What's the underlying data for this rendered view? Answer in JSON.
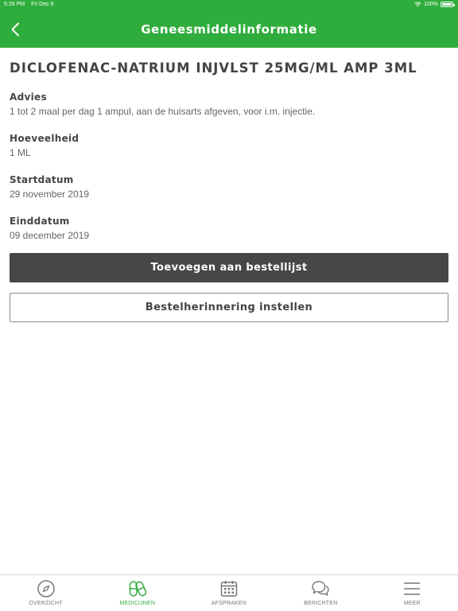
{
  "status_bar": {
    "time": "5:26 PM",
    "date": "Fri Dec 6",
    "battery": "100%"
  },
  "header": {
    "title": "Geneesmiddelinformatie"
  },
  "medication": {
    "name": "DICLOFENAC-NATRIUM INJVLST 25MG/ML AMP 3ML",
    "fields": [
      {
        "label": "Advies",
        "value": "1 tot 2 maal per dag 1 ampul, aan de huisarts afgeven, voor i.m. injectie."
      },
      {
        "label": "Hoeveelheid",
        "value": "1 ML"
      },
      {
        "label": "Startdatum",
        "value": "29 november 2019"
      },
      {
        "label": "Einddatum",
        "value": "09 december 2019"
      }
    ]
  },
  "actions": {
    "add_to_list": "Toevoegen aan bestellijst",
    "set_reminder": "Bestelherinnering instellen"
  },
  "tabs": [
    {
      "label": "OVERZICHT",
      "icon": "compass-icon",
      "active": false
    },
    {
      "label": "MEDICIJNEN",
      "icon": "pills-icon",
      "active": true
    },
    {
      "label": "AFSPRAKEN",
      "icon": "calendar-icon",
      "active": false
    },
    {
      "label": "BERICHTEN",
      "icon": "chat-bubbles-icon",
      "active": false
    },
    {
      "label": "MEER",
      "icon": "menu-icon",
      "active": false
    }
  ],
  "colors": {
    "brand": "#2fad3c",
    "primary_button": "#474747",
    "text": "#444444",
    "tab_inactive": "#777777"
  }
}
